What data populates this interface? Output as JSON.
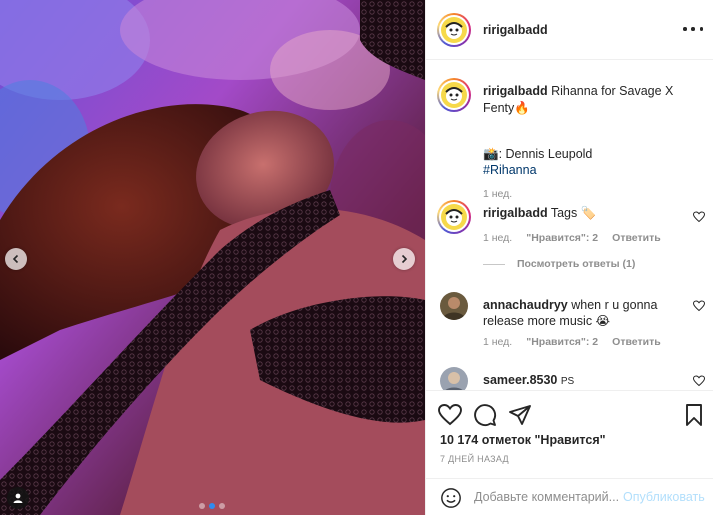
{
  "colors": {
    "accent": "#0095f6",
    "publish_disabled": "#b2dffc",
    "link": "#00376b",
    "muted": "#8e8e8e"
  },
  "media": {
    "description_icons": [
      "chevron-left-icon",
      "chevron-right-icon",
      "user-tag-icon"
    ],
    "carousel_count": 3,
    "carousel_active_index": 1
  },
  "header": {
    "username": "ririgalbadd",
    "more_icon": "ellipsis-icon"
  },
  "caption": {
    "username": "ririgalbadd",
    "text": "Rihanna for Savage X Fenty🔥",
    "credit": "📸: Dennis Leupold",
    "hashtag": "#Rihanna",
    "time": "1 нед."
  },
  "comments": [
    {
      "username": "ririgalbadd",
      "text": "Tags 🏷️",
      "time": "1 нед.",
      "likes": "\"Нравится\": 2",
      "reply": "Ответить"
    },
    {
      "username": "annachaudryy",
      "text": "when r u gonna release more music 😭",
      "time": "1 нед.",
      "likes": "\"Нравится\": 2",
      "reply": "Ответить"
    },
    {
      "username": "sameer.8530",
      "text": "PS"
    }
  ],
  "view_replies": "Посмотреть ответы (1)",
  "actions": {
    "likes": "10 174 отметок \"Нравится\"",
    "date": "7 ДНЕЙ НАЗАД"
  },
  "add_comment": {
    "placeholder": "Добавьте комментарий...",
    "publish": "Опубликовать"
  }
}
